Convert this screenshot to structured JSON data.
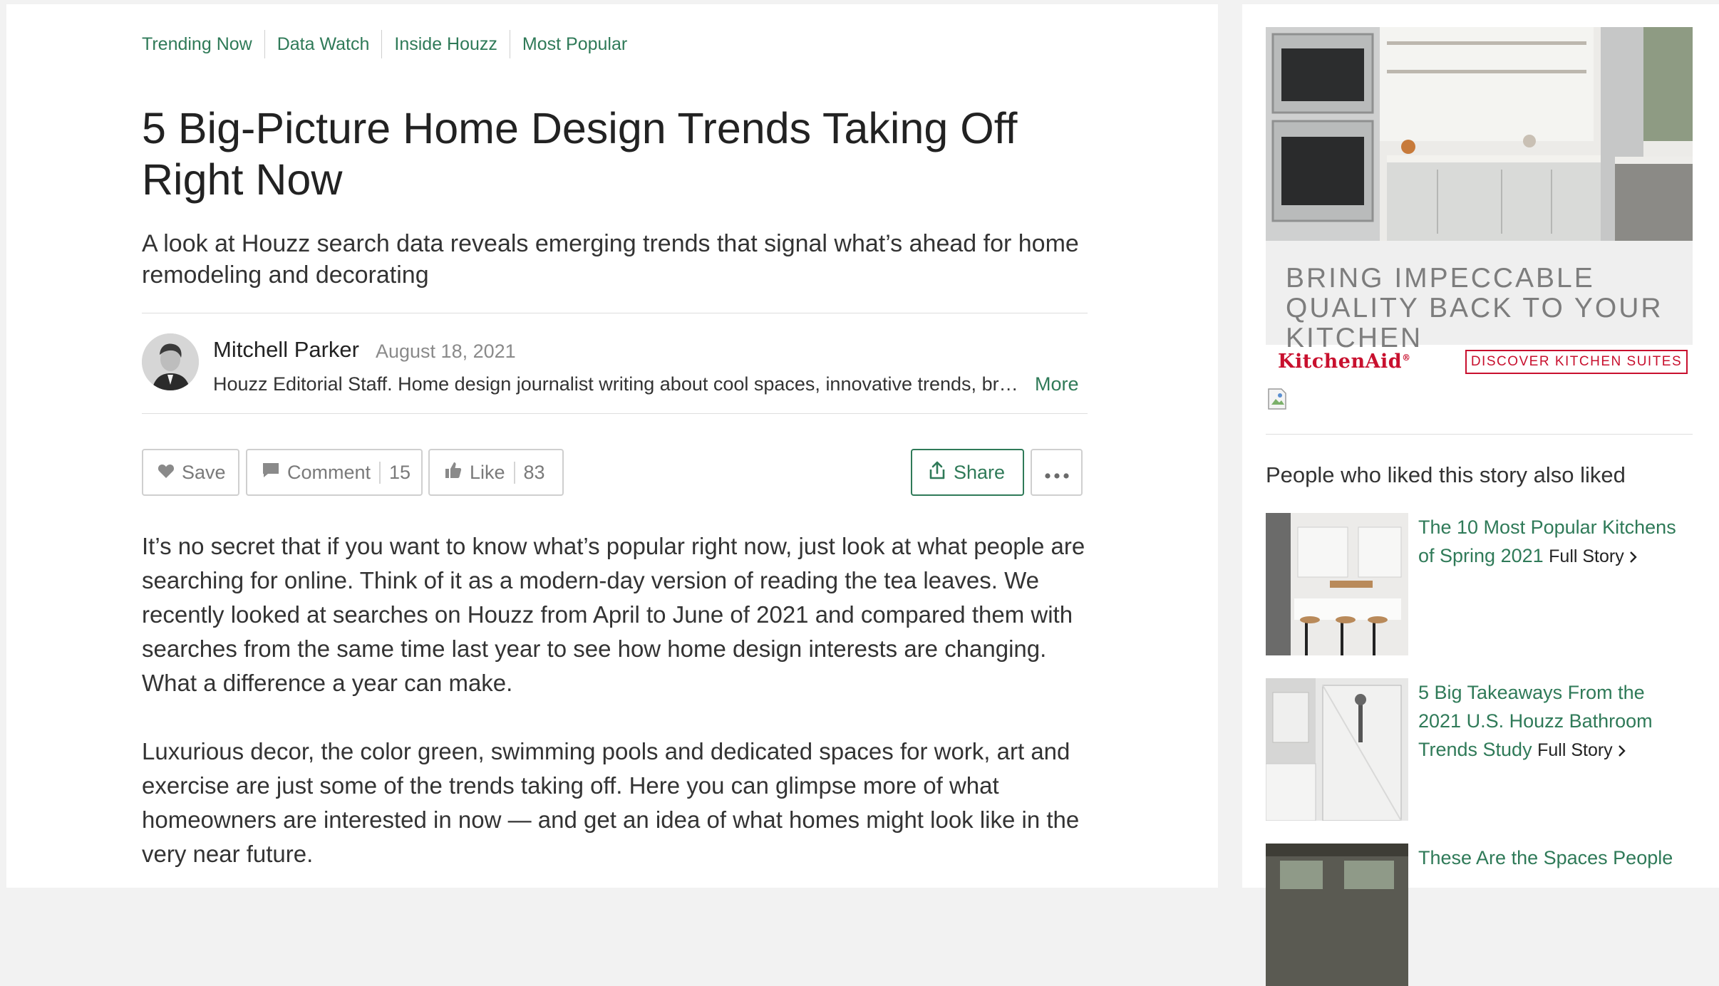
{
  "category_nav": [
    "Trending Now",
    "Data Watch",
    "Inside Houzz",
    "Most Popular"
  ],
  "article": {
    "title": "5 Big-Picture Home Design Trends Taking Off Right Now",
    "subtitle": "A look at Houzz search data reveals emerging trends that signal what’s ahead for home remodeling and decorating",
    "author": {
      "name": "Mitchell Parker",
      "date": "August 18, 2021",
      "bio": "Houzz Editorial Staff. Home design journalist writing about cool spaces, innovative trends, br…",
      "more_label": "More"
    },
    "actions": {
      "save_label": "Save",
      "comment_label": "Comment",
      "comment_count": "15",
      "like_label": "Like",
      "like_count": "83",
      "share_label": "Share"
    },
    "paragraphs": [
      "It’s no secret that if you want to know what’s popular right now, just look at what people are searching for online. Think of it as a modern-day version of reading the tea leaves. We recently looked at searches on Houzz from April to June of 2021 and compared them with searches from the same time last year to see how home design interests are changing. What a difference a year can make.",
      "Luxurious decor, the color green, swimming pools and dedicated spaces for work, art and exercise are just some of the trends taking off. Here you can glimpse more of what homeowners are interested in now — and get an idea of what homes might look like in the very near future."
    ]
  },
  "sidebar": {
    "ad": {
      "tagline": "BRING IMPECCABLE QUALITY BACK TO YOUR KITCHEN",
      "brand": "KitchenAid",
      "brand_mark": "®",
      "cta": "DISCOVER KITCHEN SUITES"
    },
    "related_heading": "People who liked this story also liked",
    "related": [
      {
        "title": "The 10 Most Popular Kitchens of Spring 2021",
        "link": "Full Story"
      },
      {
        "title": "5 Big Takeaways From the 2021 U.S. Houzz Bathroom Trends Study",
        "link": "Full Story"
      },
      {
        "title": "These Are the Spaces People",
        "link": ""
      }
    ]
  },
  "colors": {
    "accent": "#2f7a58",
    "brand_red": "#c8102e",
    "muted": "#7a7a7a"
  }
}
